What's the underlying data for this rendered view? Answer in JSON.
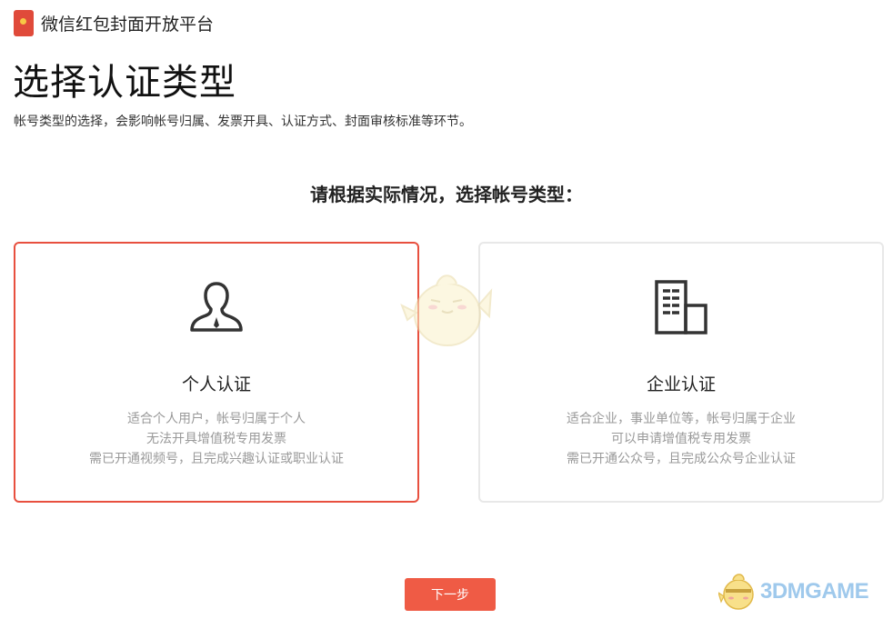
{
  "header": {
    "platform_name": "微信红包封面开放平台",
    "logo_icon": "red-packet-icon"
  },
  "page": {
    "title": "选择认证类型",
    "subtitle": "帐号类型的选择，会影响帐号归属、发票开具、认证方式、封面审核标准等环节。",
    "prompt": "请根据实际情况，选择帐号类型："
  },
  "cards": [
    {
      "id": "personal",
      "icon": "person-icon",
      "title": "个人认证",
      "selected": true,
      "desc": [
        "适合个人用户，帐号归属于个人",
        "无法开具增值税专用发票",
        "需已开通视频号，且完成兴趣认证或职业认证"
      ]
    },
    {
      "id": "enterprise",
      "icon": "building-icon",
      "title": "企业认证",
      "selected": false,
      "desc": [
        "适合企业，事业单位等，帐号归属于企业",
        "可以申请增值税专用发票",
        "需已开通公众号，且完成公众号企业认证"
      ]
    }
  ],
  "actions": {
    "next_label": "下一步"
  },
  "watermark": {
    "text": "3DMGAME"
  },
  "colors": {
    "accent": "#ef5b45",
    "selected_border": "#e8503f",
    "card_border": "#e8e8e8",
    "desc_text": "#999999"
  }
}
